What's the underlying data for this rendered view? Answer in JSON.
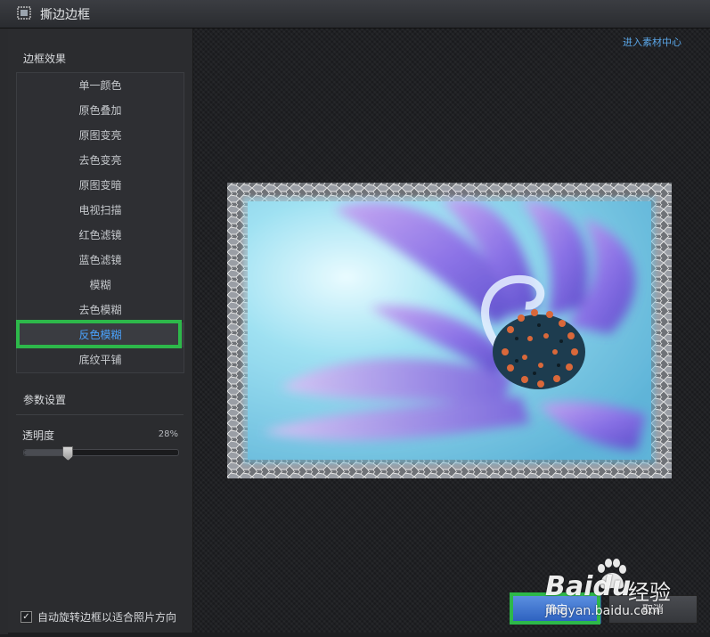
{
  "window": {
    "title": "撕边边框"
  },
  "sidebar": {
    "effects_title": "边框效果",
    "effects": [
      {
        "label": "单一颜色"
      },
      {
        "label": "原色叠加"
      },
      {
        "label": "原图变亮"
      },
      {
        "label": "去色变亮"
      },
      {
        "label": "原图变暗"
      },
      {
        "label": "电视扫描"
      },
      {
        "label": "红色滤镜"
      },
      {
        "label": "蓝色滤镜"
      },
      {
        "label": "模糊"
      },
      {
        "label": "去色模糊"
      },
      {
        "label": "反色模糊"
      },
      {
        "label": "底纹平铺"
      }
    ],
    "selected_effect": "反色模糊",
    "params_title": "参数设置",
    "opacity_label": "透明度",
    "opacity_value": "28%",
    "opacity_fraction": 0.28,
    "auto_rotate_label": "自动旋转边框以适合照片方向",
    "auto_rotate_checked": true
  },
  "preview": {
    "material_link": "进入素材中心"
  },
  "buttons": {
    "ok_label": "确定",
    "cancel_label": "取消"
  },
  "watermark": {
    "brand": "Baidu",
    "brand_suffix": "经验",
    "url": "jingyan.baidu.com"
  },
  "colors": {
    "accent": "#4aa3ff",
    "highlight": "#2db84a"
  }
}
